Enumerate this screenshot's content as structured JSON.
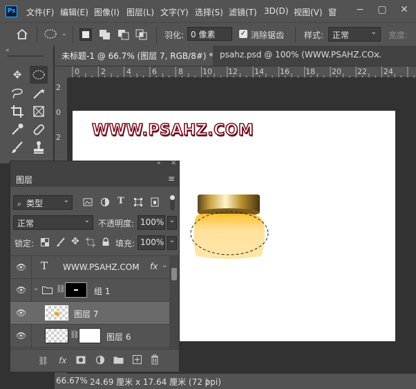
{
  "app": {
    "logo": "Ps"
  },
  "menu": [
    "文件(F)",
    "编辑(E)",
    "图像(I)",
    "图层(L)",
    "文字(Y)",
    "选择(S)",
    "滤镜(T)",
    "3D(D)",
    "视图(V)",
    "窗"
  ],
  "window_controls": {
    "minimize": "−",
    "maximize": "▢",
    "close": "✕"
  },
  "options": {
    "feather_label": "羽化:",
    "feather_value": "0 像素",
    "antialias_label": "消除锯齿",
    "style_label": "样式:",
    "style_value": "正常",
    "width_label": "宽度:"
  },
  "tabs": [
    {
      "label": "未标题-1 @ 66.7% (图层 7, RGB/8#) *",
      "close": "×"
    },
    {
      "label": "psahz.psd @ 100% (WWW.PSAHZ.CO...",
      "close": "×"
    }
  ],
  "ruler_top_labels": [
    "0",
    "2",
    "4",
    "6",
    "8",
    "10",
    "12",
    "14",
    "16",
    "18",
    "20",
    "22",
    "24"
  ],
  "ruler_left_labels": [
    "2",
    "0",
    "2"
  ],
  "canvas": {
    "watermark_text": "WWW.PSAHZ.COM"
  },
  "layers_panel": {
    "title": "图层",
    "filter_label": "类型",
    "blend_mode": "正常",
    "opacity_label": "不透明度:",
    "opacity_value": "100%",
    "lock_label": "锁定:",
    "fill_label": "填充:",
    "fill_value": "100%",
    "layers": [
      {
        "name": "WWW.PSAHZ.COM",
        "kind": "text",
        "fx": "fx"
      },
      {
        "name": "组 1",
        "kind": "group"
      },
      {
        "name": "图层 7",
        "kind": "pixel",
        "selected": true
      },
      {
        "name": "图层 6",
        "kind": "masked"
      }
    ],
    "footer_icons": [
      "link-icon",
      "fx-icon",
      "mask-icon",
      "adjustment-icon",
      "folder-icon",
      "new-layer-icon",
      "trash-icon"
    ],
    "footer_fx": "fx"
  },
  "status": {
    "zoom": "66.67%",
    "doc_size": "24.69 厘米 x 17.64 厘米 (72 ppi)",
    "arrow": "〉"
  },
  "colors": {
    "panel": "#535353",
    "dark": "#323232",
    "accent": "#31a8ff",
    "watermark_stroke": "#7a1020"
  }
}
